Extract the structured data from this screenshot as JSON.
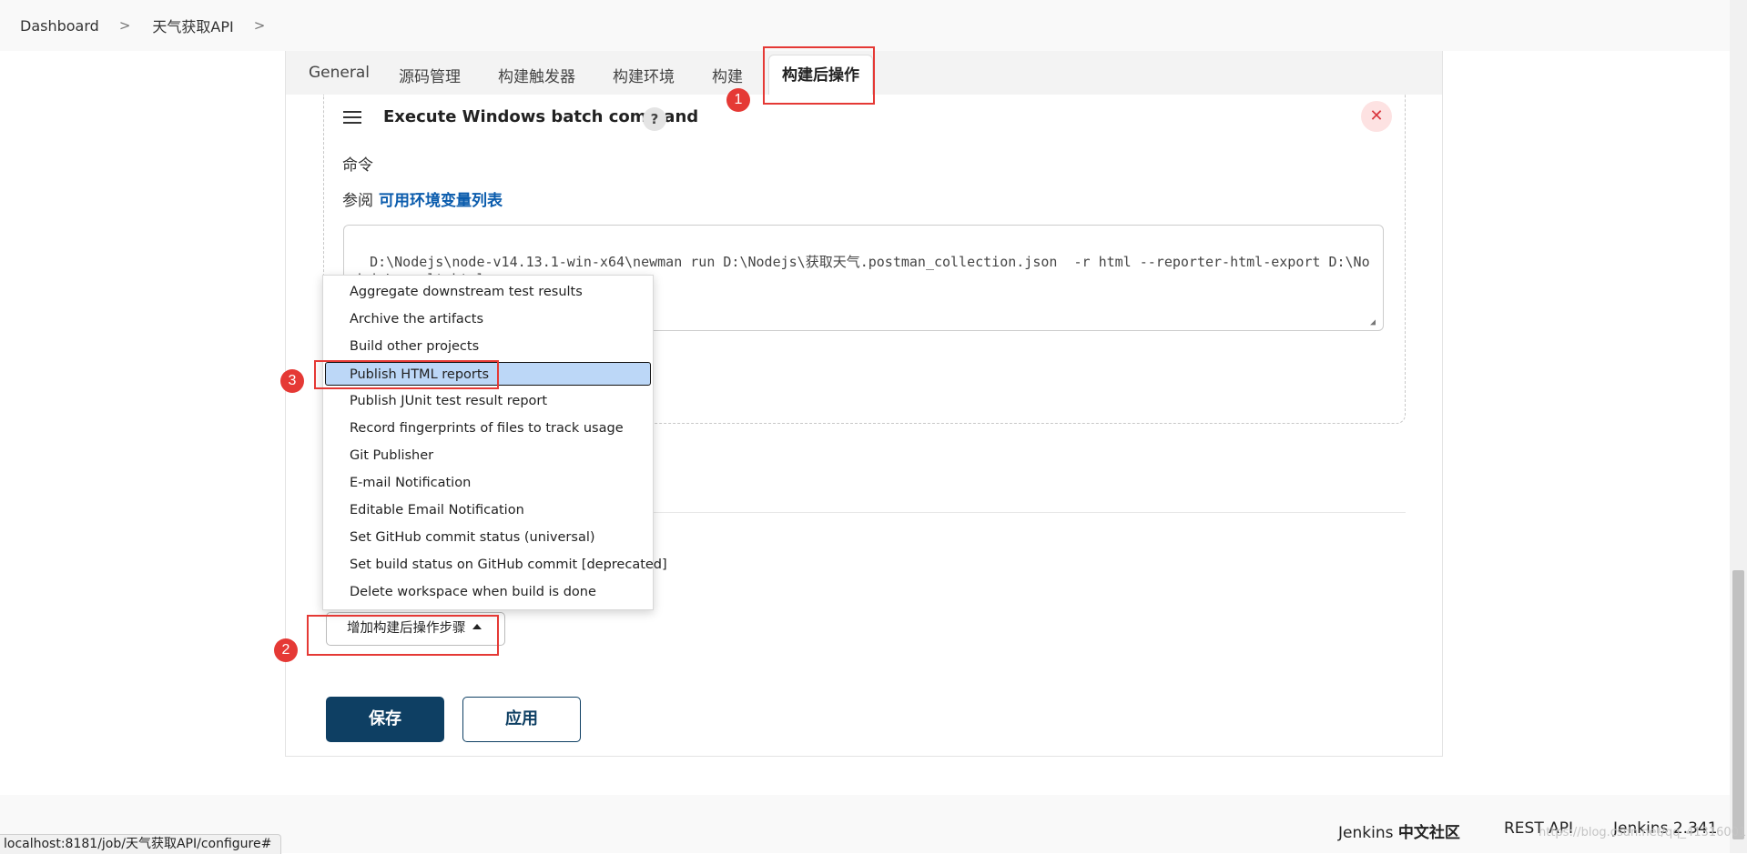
{
  "breadcrumb": {
    "items": [
      "Dashboard",
      "天气获取API"
    ],
    "separator": ">"
  },
  "tabs": [
    {
      "label": "General",
      "active": false
    },
    {
      "label": "源码管理",
      "active": false
    },
    {
      "label": "构建触发器",
      "active": false
    },
    {
      "label": "构建环境",
      "active": false
    },
    {
      "label": "构建",
      "active": false
    },
    {
      "label": "构建后操作",
      "active": true
    }
  ],
  "build_step": {
    "title": "Execute Windows batch command",
    "help_icon": "?",
    "close_icon": "✕",
    "command_label": "命令",
    "see_also_prefix": "参阅",
    "see_also_link": "可用环境变量列表",
    "command_value": "D:\\Nodejs\\node-v14.13.1-win-x64\\newman run D:\\Nodejs\\获取天气.postman_collection.json  -r html --reporter-html-export D:\\Nodejs\\result.html"
  },
  "dropdown": {
    "items": [
      "Aggregate downstream test results",
      "Archive the artifacts",
      "Build other projects",
      "Publish HTML reports",
      "Publish JUnit test result report",
      "Record fingerprints of files to track usage",
      "Git Publisher",
      "E-mail Notification",
      "Editable Email Notification",
      "Set GitHub commit status (universal)",
      "Set build status on GitHub commit [deprecated]",
      "Delete workspace when build is done"
    ],
    "selected": "Publish HTML reports"
  },
  "add_step_button": "增加构建后操作步骤",
  "save_button": "保存",
  "apply_button": "应用",
  "footer": {
    "community_prefix": "Jenkins",
    "community_suffix": "中文社区",
    "rest_api": "REST API",
    "version": "Jenkins 2.341"
  },
  "status_url": "localhost:8181/job/天气获取API/configure#",
  "watermark": "https://blog.csdn.net/qq_41316001",
  "annotations": [
    "1",
    "2",
    "3"
  ],
  "colors": {
    "accent": "#0e3f63",
    "link": "#0b5cad",
    "annotation": "#e53935",
    "selected_item": "#bcd7f7"
  }
}
